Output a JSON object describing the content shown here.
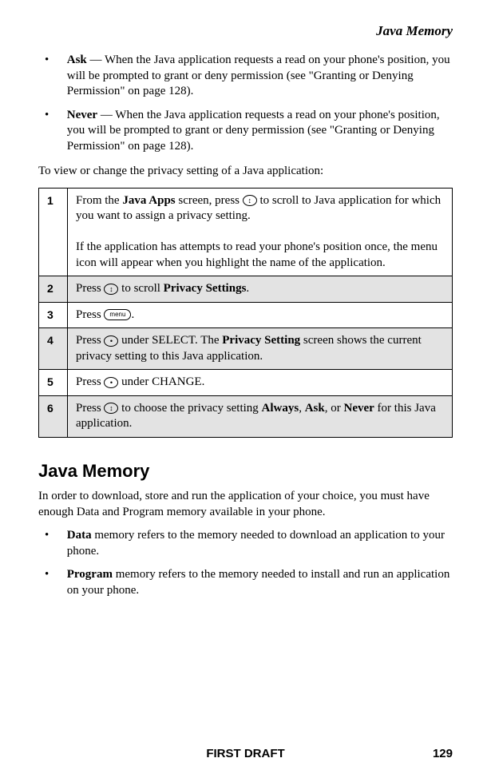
{
  "header": {
    "title": "Java Memory"
  },
  "topList": [
    {
      "term": "Ask",
      "rest": " — When the Java application requests a read on your phone's position, you will be prompted to grant or deny permission (see \"Granting or Denying Permission\" on page 128)."
    },
    {
      "term": "Never",
      "rest": " — When the Java application requests a read on your phone's position, you will be prompted to grant or deny permission (see \"Granting or Denying Permission\" on page 128)."
    }
  ],
  "introLine": "To view or change the privacy setting of a Java application:",
  "icons": {
    "scroll": "↕",
    "menu": "menu",
    "dot": "•"
  },
  "steps": [
    {
      "n": "1",
      "pre": "From the ",
      "b1": "Java Apps",
      "mid1": " screen, press ",
      "iconKey": "scroll",
      "post": " to scroll to Java application for which you want to assign a privacy setting.",
      "extra": "If the application has attempts to read your phone's position once, the menu icon will appear when you highlight the name of the application."
    },
    {
      "n": "2",
      "pre": "Press ",
      "iconKey": "scroll",
      "mid1": " to scroll ",
      "b1": "Privacy Settings",
      "post": "."
    },
    {
      "n": "3",
      "pre": "Press ",
      "iconKey": "menu",
      "post": "."
    },
    {
      "n": "4",
      "pre": "Press ",
      "iconKey": "dot",
      "mid1": " under SELECT. The ",
      "b1": "Privacy Setting",
      "post": " screen shows the current privacy setting to this Java application."
    },
    {
      "n": "5",
      "pre": "Press ",
      "iconKey": "dot",
      "post": " under CHANGE."
    },
    {
      "n": "6",
      "pre": "Press ",
      "iconKey": "scroll",
      "mid1": " to choose the privacy setting ",
      "b1": "Always",
      "mid2": ", ",
      "b2": "Ask",
      "mid3": ", or ",
      "b3": "Never",
      "post": " for this Java application."
    }
  ],
  "section": {
    "title": "Java Memory",
    "p1": "In order to download, store and run the application of your choice, you must have enough Data and Program memory available in your phone.",
    "bullets": [
      {
        "term": "Data",
        "rest": " memory refers to the memory needed to download an application to your phone."
      },
      {
        "term": "Program",
        "rest": " memory refers to the memory needed to install and run an application on your phone."
      }
    ]
  },
  "footer": {
    "draft": "FIRST DRAFT",
    "page": "129"
  }
}
